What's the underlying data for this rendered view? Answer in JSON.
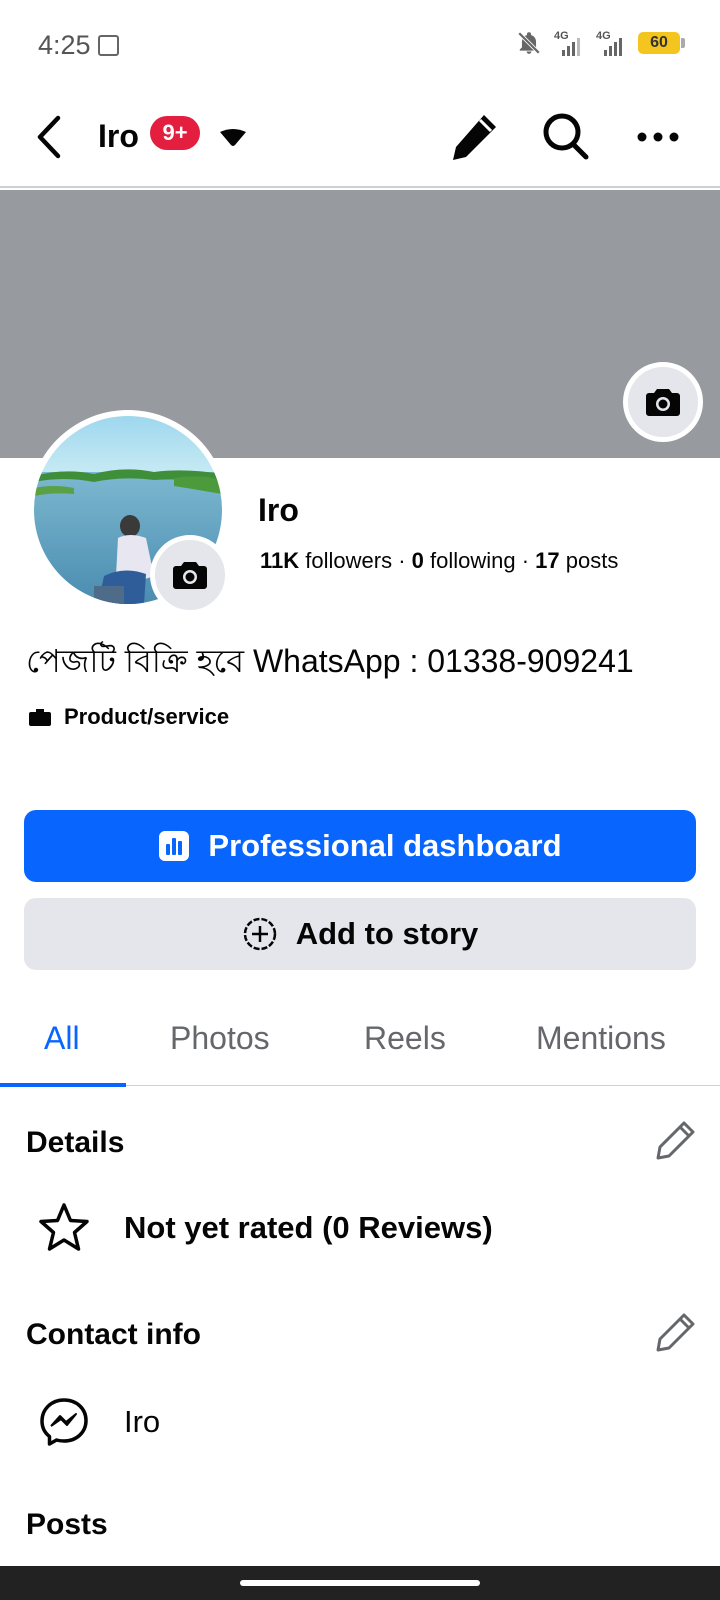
{
  "status_bar": {
    "time": "4:25",
    "network_1": "4G",
    "network_2": "4G",
    "battery": "60"
  },
  "header": {
    "title": "Iro",
    "notification_badge": "9+"
  },
  "profile": {
    "name": "Iro",
    "followers_count": "11K",
    "followers_label": " followers · ",
    "following_count": "0",
    "following_label": " following · ",
    "posts_count": "17",
    "posts_label": " posts",
    "bio": "পেজটি বিক্রি হবে WhatsApp : 01338-909241",
    "category": "Product/service"
  },
  "buttons": {
    "professional_dashboard": "Professional dashboard",
    "add_to_story": "Add to story"
  },
  "tabs": [
    {
      "label": "All",
      "active": true
    },
    {
      "label": "Photos",
      "active": false
    },
    {
      "label": "Reels",
      "active": false
    },
    {
      "label": "Mentions",
      "active": false
    }
  ],
  "details": {
    "title": "Details",
    "rating": "Not yet rated (0 Reviews)"
  },
  "contact_info": {
    "title": "Contact info",
    "messenger": "Iro"
  },
  "posts": {
    "title": "Posts"
  },
  "colors": {
    "accent": "#0866ff",
    "badge": "#e41e3f",
    "cover": "#979a9e",
    "secondary_button": "#e4e6eb"
  }
}
